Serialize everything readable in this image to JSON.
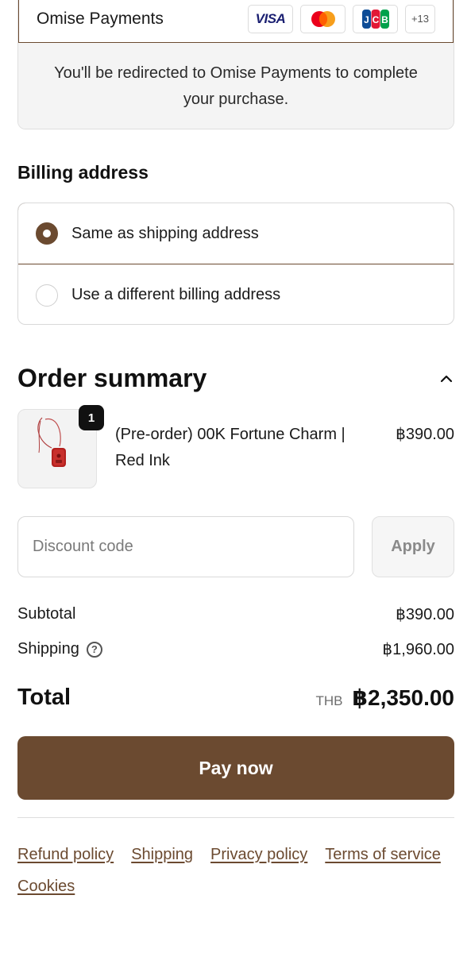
{
  "payment": {
    "provider_name": "Omise Payments",
    "logos": [
      "VISA",
      "mastercard",
      "JCB"
    ],
    "more_count": "+13",
    "note": "You'll be redirected to Omise Payments to complete your purchase."
  },
  "billing": {
    "title": "Billing address",
    "options": [
      {
        "label": "Same as shipping address",
        "selected": true
      },
      {
        "label": "Use a different billing address",
        "selected": false
      }
    ]
  },
  "summary": {
    "title": "Order summary",
    "item": {
      "quantity": "1",
      "name": "(Pre-order) 00K Fortune Charm | Red Ink",
      "price": "฿390.00"
    },
    "discount": {
      "placeholder": "Discount code",
      "apply_label": "Apply"
    },
    "subtotal": {
      "label": "Subtotal",
      "value": "฿390.00"
    },
    "shipping": {
      "label": "Shipping",
      "value": "฿1,960.00"
    },
    "total": {
      "label": "Total",
      "currency": "THB",
      "value": "฿2,350.00"
    }
  },
  "actions": {
    "pay_label": "Pay now"
  },
  "footer": {
    "links": [
      "Refund policy",
      "Shipping",
      "Privacy policy",
      "Terms of service",
      "Cookies"
    ]
  },
  "colors": {
    "accent": "#6b4a30"
  }
}
